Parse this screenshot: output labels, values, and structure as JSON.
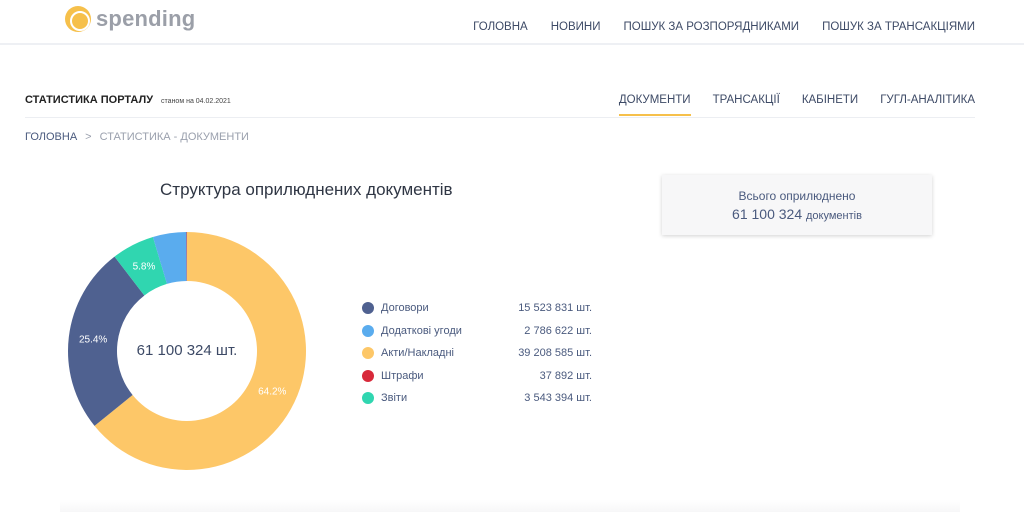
{
  "app": {
    "logo_text": "spending"
  },
  "topnav": [
    "ГОЛОВНА",
    "НОВИНИ",
    "ПОШУК ЗА РОЗПОРЯДНИКАМИ",
    "ПОШУК ЗА ТРАНСАКЦІЯМИ"
  ],
  "section": {
    "title": "СТАТИСТИКА ПОРТАЛУ",
    "date": "станом на 04.02.2021"
  },
  "tabs": [
    {
      "label": "ДОКУМЕНТИ",
      "active": true
    },
    {
      "label": "ТРАНСАКЦІЇ",
      "active": false
    },
    {
      "label": "КАБІНЕТИ",
      "active": false
    },
    {
      "label": "ГУГЛ-АНАЛІТИКА",
      "active": false
    }
  ],
  "breadcrumb": {
    "home": "ГОЛОВНА",
    "separator": ">",
    "current": "СТАТИСТИКА - ДОКУМЕНТИ"
  },
  "total_card": {
    "line1": "Всього оприлюднено",
    "number": "61 100 324",
    "unit": "документів"
  },
  "colors": {
    "contracts": "#4f6190",
    "addenda": "#5aacee",
    "acts": "#fdc768",
    "fines": "#d8293a",
    "reports": "#30d6b0",
    "accent": "#f6c04b"
  },
  "chart_data": {
    "type": "pie",
    "title": "Структура оприлюднених документів",
    "center_label": "61 100 324 шт.",
    "slices": [
      {
        "name": "Договори",
        "value": 15523831,
        "display": "15 523 831 шт.",
        "label": "25.4%",
        "color": "#4f6190"
      },
      {
        "name": "Додаткові угоди",
        "value": 2786622,
        "display": "2 786 622 шт.",
        "label": "",
        "color": "#5aacee"
      },
      {
        "name": "Акти/Накладні",
        "value": 39208585,
        "display": "39 208 585 шт.",
        "label": "64.2%",
        "color": "#fdc768"
      },
      {
        "name": "Штрафи",
        "value": 37892,
        "display": "37 892 шт.",
        "label": "",
        "color": "#d8293a"
      },
      {
        "name": "Звіти",
        "value": 3543394,
        "display": "3 543 394 шт.",
        "label": "5.8%",
        "color": "#30d6b0"
      }
    ],
    "draw_order": [
      "Акти/Накладні",
      "Договори",
      "Звіти",
      "Додаткові угоди",
      "Штрафи"
    ],
    "legend_position": "right"
  }
}
